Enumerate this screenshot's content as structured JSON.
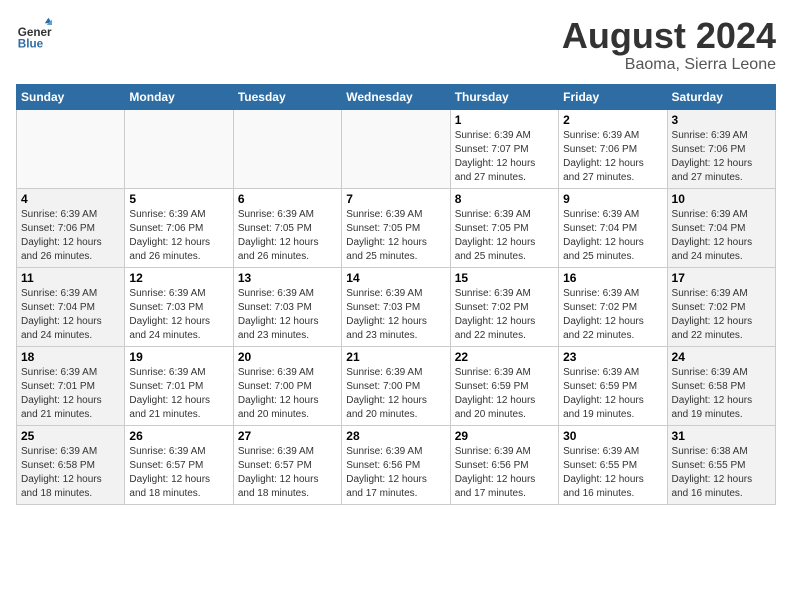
{
  "header": {
    "logo_line1": "General",
    "logo_line2": "Blue",
    "month_year": "August 2024",
    "location": "Baoma, Sierra Leone"
  },
  "weekdays": [
    "Sunday",
    "Monday",
    "Tuesday",
    "Wednesday",
    "Thursday",
    "Friday",
    "Saturday"
  ],
  "weeks": [
    [
      {
        "day": "",
        "info": ""
      },
      {
        "day": "",
        "info": ""
      },
      {
        "day": "",
        "info": ""
      },
      {
        "day": "",
        "info": ""
      },
      {
        "day": "1",
        "info": "Sunrise: 6:39 AM\nSunset: 7:07 PM\nDaylight: 12 hours\nand 27 minutes."
      },
      {
        "day": "2",
        "info": "Sunrise: 6:39 AM\nSunset: 7:06 PM\nDaylight: 12 hours\nand 27 minutes."
      },
      {
        "day": "3",
        "info": "Sunrise: 6:39 AM\nSunset: 7:06 PM\nDaylight: 12 hours\nand 27 minutes."
      }
    ],
    [
      {
        "day": "4",
        "info": "Sunrise: 6:39 AM\nSunset: 7:06 PM\nDaylight: 12 hours\nand 26 minutes."
      },
      {
        "day": "5",
        "info": "Sunrise: 6:39 AM\nSunset: 7:06 PM\nDaylight: 12 hours\nand 26 minutes."
      },
      {
        "day": "6",
        "info": "Sunrise: 6:39 AM\nSunset: 7:05 PM\nDaylight: 12 hours\nand 26 minutes."
      },
      {
        "day": "7",
        "info": "Sunrise: 6:39 AM\nSunset: 7:05 PM\nDaylight: 12 hours\nand 25 minutes."
      },
      {
        "day": "8",
        "info": "Sunrise: 6:39 AM\nSunset: 7:05 PM\nDaylight: 12 hours\nand 25 minutes."
      },
      {
        "day": "9",
        "info": "Sunrise: 6:39 AM\nSunset: 7:04 PM\nDaylight: 12 hours\nand 25 minutes."
      },
      {
        "day": "10",
        "info": "Sunrise: 6:39 AM\nSunset: 7:04 PM\nDaylight: 12 hours\nand 24 minutes."
      }
    ],
    [
      {
        "day": "11",
        "info": "Sunrise: 6:39 AM\nSunset: 7:04 PM\nDaylight: 12 hours\nand 24 minutes."
      },
      {
        "day": "12",
        "info": "Sunrise: 6:39 AM\nSunset: 7:03 PM\nDaylight: 12 hours\nand 24 minutes."
      },
      {
        "day": "13",
        "info": "Sunrise: 6:39 AM\nSunset: 7:03 PM\nDaylight: 12 hours\nand 23 minutes."
      },
      {
        "day": "14",
        "info": "Sunrise: 6:39 AM\nSunset: 7:03 PM\nDaylight: 12 hours\nand 23 minutes."
      },
      {
        "day": "15",
        "info": "Sunrise: 6:39 AM\nSunset: 7:02 PM\nDaylight: 12 hours\nand 22 minutes."
      },
      {
        "day": "16",
        "info": "Sunrise: 6:39 AM\nSunset: 7:02 PM\nDaylight: 12 hours\nand 22 minutes."
      },
      {
        "day": "17",
        "info": "Sunrise: 6:39 AM\nSunset: 7:02 PM\nDaylight: 12 hours\nand 22 minutes."
      }
    ],
    [
      {
        "day": "18",
        "info": "Sunrise: 6:39 AM\nSunset: 7:01 PM\nDaylight: 12 hours\nand 21 minutes."
      },
      {
        "day": "19",
        "info": "Sunrise: 6:39 AM\nSunset: 7:01 PM\nDaylight: 12 hours\nand 21 minutes."
      },
      {
        "day": "20",
        "info": "Sunrise: 6:39 AM\nSunset: 7:00 PM\nDaylight: 12 hours\nand 20 minutes."
      },
      {
        "day": "21",
        "info": "Sunrise: 6:39 AM\nSunset: 7:00 PM\nDaylight: 12 hours\nand 20 minutes."
      },
      {
        "day": "22",
        "info": "Sunrise: 6:39 AM\nSunset: 6:59 PM\nDaylight: 12 hours\nand 20 minutes."
      },
      {
        "day": "23",
        "info": "Sunrise: 6:39 AM\nSunset: 6:59 PM\nDaylight: 12 hours\nand 19 minutes."
      },
      {
        "day": "24",
        "info": "Sunrise: 6:39 AM\nSunset: 6:58 PM\nDaylight: 12 hours\nand 19 minutes."
      }
    ],
    [
      {
        "day": "25",
        "info": "Sunrise: 6:39 AM\nSunset: 6:58 PM\nDaylight: 12 hours\nand 18 minutes."
      },
      {
        "day": "26",
        "info": "Sunrise: 6:39 AM\nSunset: 6:57 PM\nDaylight: 12 hours\nand 18 minutes."
      },
      {
        "day": "27",
        "info": "Sunrise: 6:39 AM\nSunset: 6:57 PM\nDaylight: 12 hours\nand 18 minutes."
      },
      {
        "day": "28",
        "info": "Sunrise: 6:39 AM\nSunset: 6:56 PM\nDaylight: 12 hours\nand 17 minutes."
      },
      {
        "day": "29",
        "info": "Sunrise: 6:39 AM\nSunset: 6:56 PM\nDaylight: 12 hours\nand 17 minutes."
      },
      {
        "day": "30",
        "info": "Sunrise: 6:39 AM\nSunset: 6:55 PM\nDaylight: 12 hours\nand 16 minutes."
      },
      {
        "day": "31",
        "info": "Sunrise: 6:38 AM\nSunset: 6:55 PM\nDaylight: 12 hours\nand 16 minutes."
      }
    ]
  ]
}
